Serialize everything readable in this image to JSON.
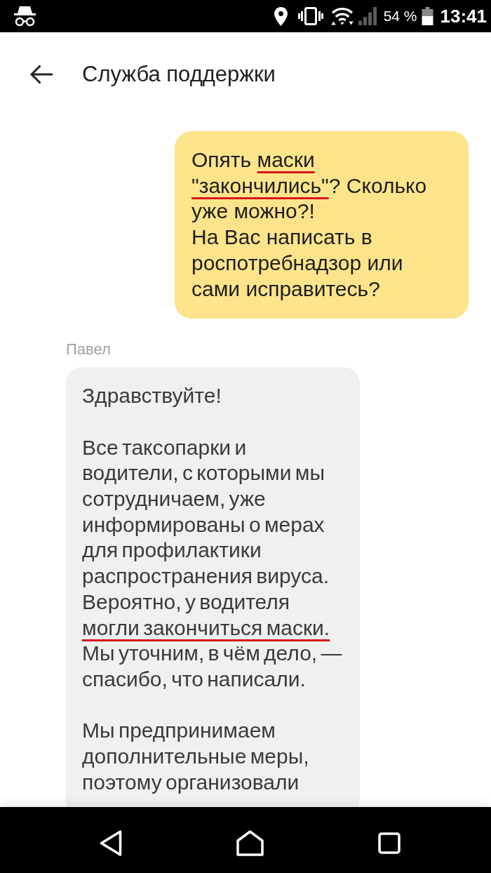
{
  "status_bar": {
    "battery_percent": "54 %",
    "time": "13:41"
  },
  "header": {
    "title": "Служба поддержки"
  },
  "messages": [
    {
      "kind": "outgoing",
      "segments": [
        {
          "text": "Опять ",
          "underlined": false
        },
        {
          "text": "маски ",
          "underlined": true
        },
        {
          "text": "\"закончились\"",
          "underlined": true
        },
        {
          "text": "? Сколько уже можно?!\nНа Вас написать в роспотребнадзор или сами исправитесь?",
          "underlined": false
        }
      ]
    },
    {
      "kind": "incoming",
      "sender": "Павел",
      "segments": [
        {
          "text": "Здравствуйте!\n\nВсе таксопарки и водители, с которыми мы сотрудничаем, уже информированы о мерах для профилактики распространения вируса. Вероятно, у водителя ",
          "underlined": false
        },
        {
          "text": "могли закончиться маски.",
          "underlined": true
        },
        {
          "text": " Мы уточним, в чём дело, — спасибо, что написали.\n\nМы предпринимаем дополнительные меры, поэтому организовали",
          "underlined": false
        }
      ]
    }
  ]
}
